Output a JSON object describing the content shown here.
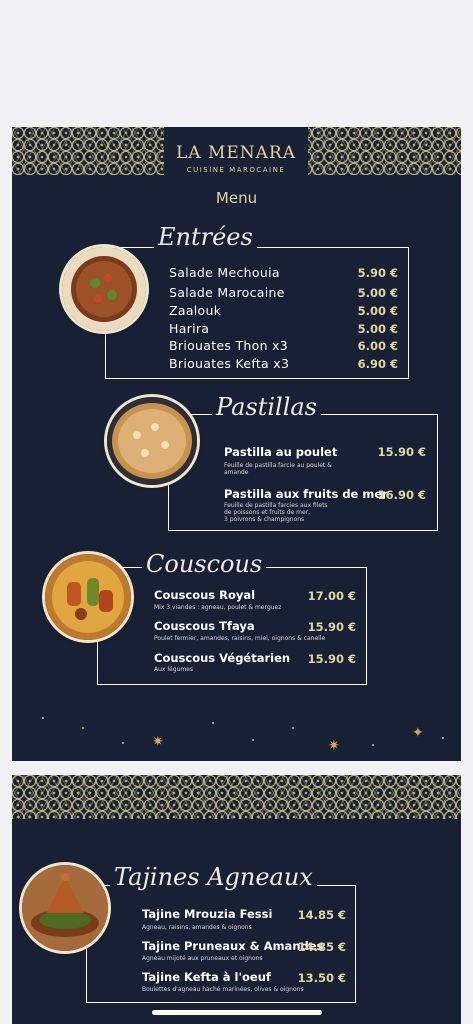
{
  "brand": {
    "name": "LA MENARA",
    "subtitle": "CUISINE MAROCAINE"
  },
  "menu_title": "Menu",
  "sections": {
    "entrees": {
      "title": "Entrées",
      "items": [
        {
          "name": "Salade Mechouia",
          "price": "5.90 €"
        },
        {
          "name": "Salade Marocaine",
          "price": "5.00 €"
        },
        {
          "name": "Zaalouk",
          "price": "5.00 €"
        },
        {
          "name": "Harira",
          "price": "5.00 €"
        },
        {
          "name": "Briouates Thon  x3",
          "price": "6.00 €"
        },
        {
          "name": "Briouates Kefta  x3",
          "price": "6.90 €"
        }
      ]
    },
    "pastillas": {
      "title": "Pastillas",
      "items": [
        {
          "name": "Pastilla au poulet",
          "price": "15.90 €",
          "desc": [
            "Feuille de pastilla farcie au poulet &",
            "amande"
          ]
        },
        {
          "name": "Pastilla aux fruits de mer",
          "price": "16.90 €",
          "desc": [
            "Feuille de pastilla farcies aux filets",
            "de poissons et fruits de mer,",
            "3 poivrons & champignons"
          ]
        }
      ]
    },
    "couscous": {
      "title": "Couscous",
      "items": [
        {
          "name": "Couscous Royal",
          "price": "17.00 €",
          "desc": [
            "Mix 3 viandes : agneau, poulet & merguez"
          ]
        },
        {
          "name": "Couscous Tfaya",
          "price": "15.90 €",
          "desc": [
            "Poulet fermier, amandes, raisins, miel, oignons & canelle"
          ]
        },
        {
          "name": "Couscous Végétarien",
          "price": "15.90 €",
          "desc": [
            "Aux légumes"
          ]
        }
      ]
    },
    "tajines": {
      "title": "Tajines Agneaux",
      "items": [
        {
          "name": "Tajine Mrouzia Fessi",
          "price": "14.85 €",
          "desc": [
            "Agneau, raisins, amandes & oignons"
          ]
        },
        {
          "name": "Tajine Pruneaux & Amandes",
          "price": "14.85 €",
          "desc": [
            "Agneau mijoté aux pruneaux et oignons"
          ]
        },
        {
          "name": "Tajine Kefta à l'oeuf",
          "price": "13.50 €",
          "desc": [
            "Boulettes d'agneau haché marinées, olives & oignons"
          ]
        }
      ]
    }
  },
  "colors": {
    "background": "#172035",
    "gold": "#e2d79a",
    "text": "#ffffff"
  }
}
